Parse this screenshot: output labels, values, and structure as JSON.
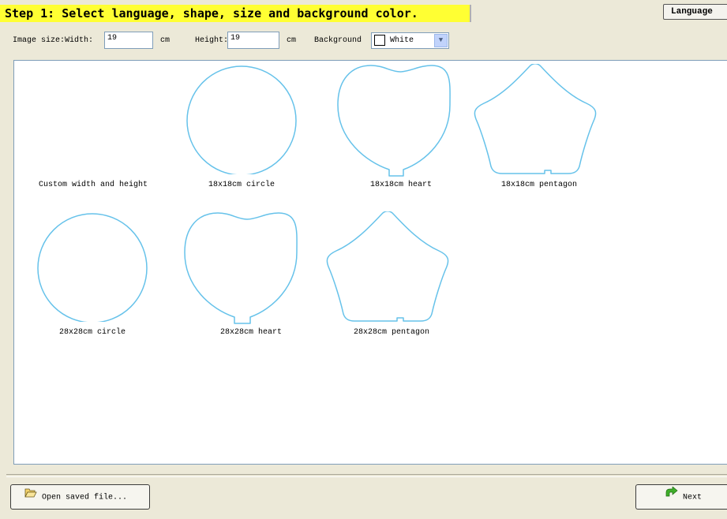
{
  "header": {
    "title": "Step 1: Select language, shape, size and background color.",
    "language_button": "Language"
  },
  "settings": {
    "image_size_label": "Image size:Width:",
    "width_value": "19",
    "width_unit": "cm",
    "height_label": "Height:",
    "height_value": "19",
    "height_unit": "cm",
    "background_label": "Background",
    "background_value": "White",
    "background_swatch_color": "#ffffff"
  },
  "shapes": [
    {
      "caption": "Custom width and height",
      "kind": "custom"
    },
    {
      "caption": "18x18cm circle",
      "kind": "circle"
    },
    {
      "caption": "18x18cm heart",
      "kind": "heart"
    },
    {
      "caption": "18x18cm pentagon",
      "kind": "pentagon"
    },
    {
      "caption": "28x28cm circle",
      "kind": "circle"
    },
    {
      "caption": "28x28cm heart",
      "kind": "heart"
    },
    {
      "caption": "28x28cm pentagon",
      "kind": "pentagon"
    }
  ],
  "footer": {
    "open_button": "Open saved file...",
    "next_button": "Next"
  },
  "colors": {
    "title_highlight": "#ffff33",
    "shape_outline": "#66c2ea",
    "window_bg": "#ece9d8"
  }
}
